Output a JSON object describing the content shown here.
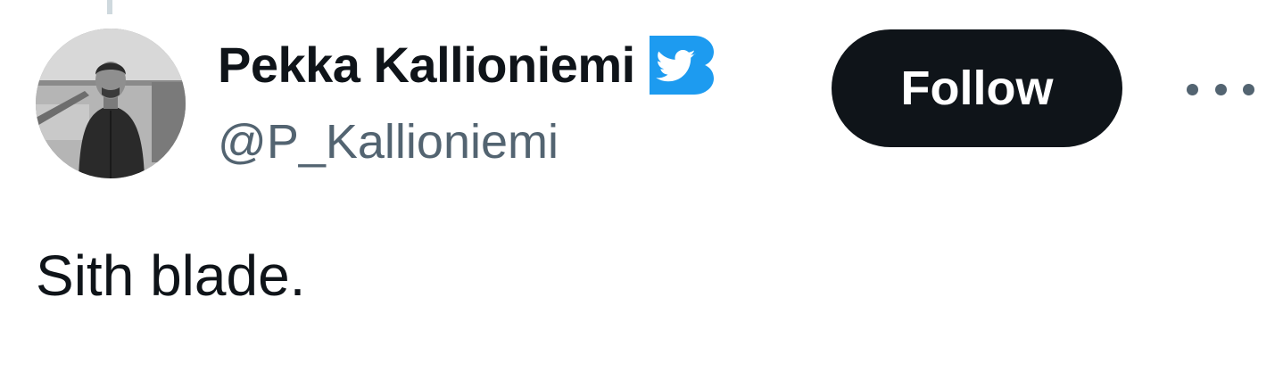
{
  "tweet": {
    "author": {
      "display_name": "Pekka Kallioniemi",
      "handle": "@P_Kallioniemi",
      "avatar_icon": "profile-photo",
      "verified_icon": "twitter-bird-verified-icon"
    },
    "follow_label": "Follow",
    "more_icon": "more-horizontal-icon",
    "text": "Sith blade."
  },
  "colors": {
    "text_primary": "#0f1419",
    "text_secondary": "#536471",
    "button_bg": "#0f1419",
    "button_text": "#ffffff",
    "verified_blue": "#1d9bf0",
    "thread_line": "#cfd9de"
  }
}
